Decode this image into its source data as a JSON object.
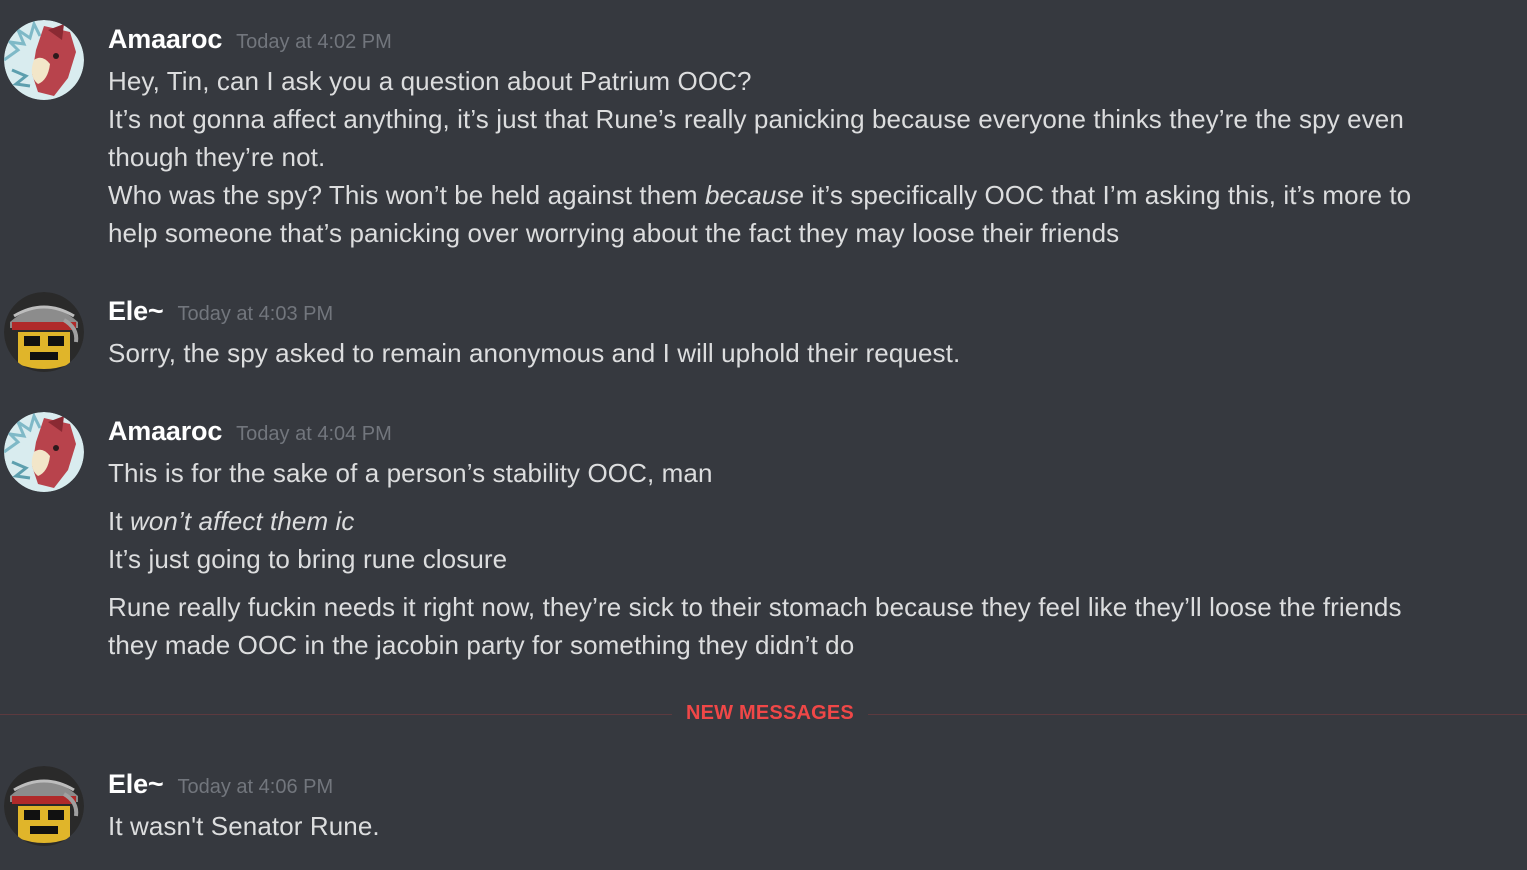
{
  "messages": [
    {
      "author": "Amaaroc",
      "avatar": "amaaroc-avatar",
      "timestamp": "Today at 4:02 PM",
      "lines": [
        "Hey, Tin, can I ask you a question about Patrium OOC?",
        "It’s not gonna affect anything, it’s just that Rune’s really panicking because everyone thinks they’re the spy even",
        "though they’re not.",
        {
          "before": "Who was the spy? This won’t be held against them ",
          "italic": "because",
          "after": " it’s specifically OOC that I’m asking this, it’s more to"
        },
        "help someone that’s panicking over worrying about the fact they may loose their friends"
      ]
    },
    {
      "author": "Ele~",
      "avatar": "ele-avatar",
      "timestamp": "Today at 4:03 PM",
      "lines": [
        "Sorry, the spy asked to remain anonymous and I will uphold their request."
      ]
    },
    {
      "author": "Amaaroc",
      "avatar": "amaaroc-avatar",
      "timestamp": "Today at 4:04 PM",
      "lines": [
        "This is for the sake of a person’s stability OOC, man",
        {
          "before": "It ",
          "italic": "won’t affect them ic",
          "after": ""
        },
        "It’s just going to bring rune closure",
        "Rune really fuckin needs it right now, they’re sick to their stomach because they feel like they’ll loose the friends",
        "they made OOC in the jacobin party for something they didn’t do"
      ]
    },
    {
      "author": "Ele~",
      "avatar": "ele-avatar",
      "timestamp": "Today at 4:06 PM",
      "lines": [
        "It wasn't Senator Rune."
      ]
    }
  ],
  "divider": {
    "label": "NEW MESSAGES"
  },
  "colors": {
    "background": "#36393f",
    "username": "#ffffff",
    "timestamp": "#72767d",
    "text": "#dcddde",
    "new_messages": "#f04747"
  }
}
